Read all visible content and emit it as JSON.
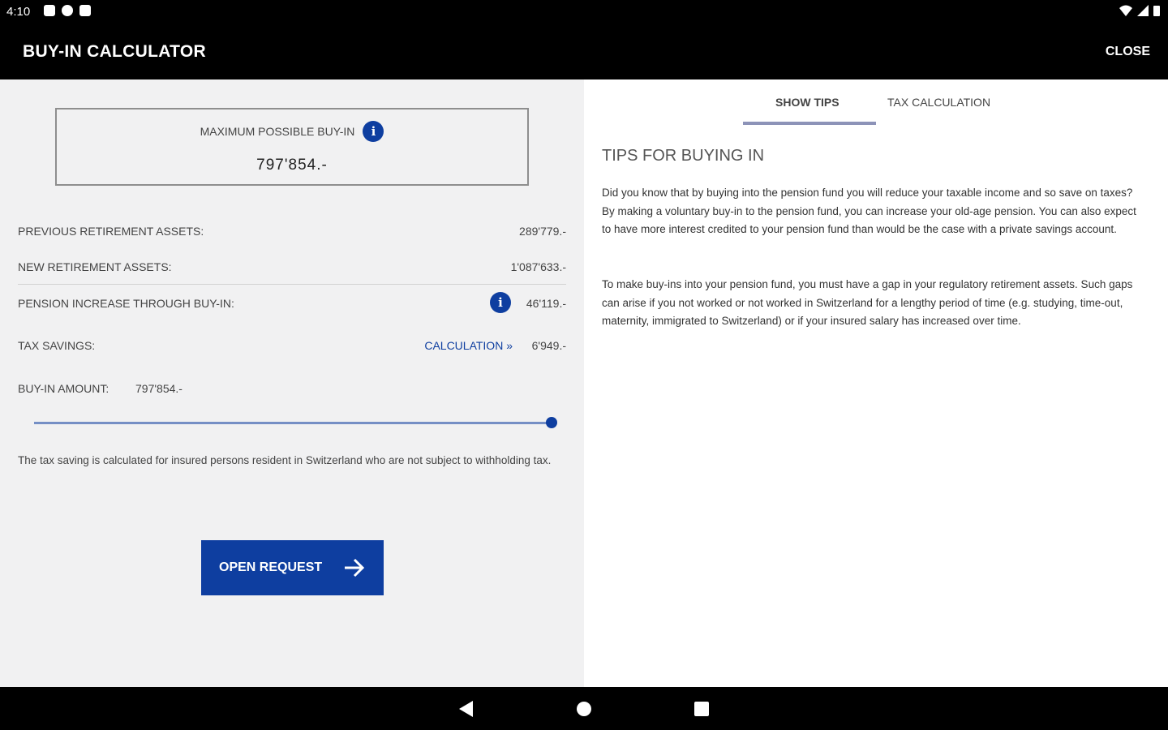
{
  "status_bar": {
    "time": "4:10"
  },
  "app_bar": {
    "title": "BUY-IN CALCULATOR",
    "close_label": "CLOSE"
  },
  "left_panel": {
    "max_buyin": {
      "label": "MAXIMUM POSSIBLE BUY-IN",
      "value": "797'854.-"
    },
    "rows": [
      {
        "label": "PREVIOUS RETIREMENT ASSETS:",
        "value": "289'779.-"
      },
      {
        "label": "NEW RETIREMENT ASSETS:",
        "value": "1'087'633.-"
      },
      {
        "label": "PENSION INCREASE THROUGH BUY-IN:",
        "value": "46'119.-"
      },
      {
        "label": "TAX SAVINGS:",
        "link": "CALCULATION »",
        "value": "6'949.-"
      }
    ],
    "buyin_amount": {
      "label": "BUY-IN AMOUNT:",
      "value": "797'854.-"
    },
    "slider_fraction": 1.0,
    "note": "The tax saving is calculated for insured persons resident in Switzerland who are not subject to withholding tax.",
    "button_label": "OPEN REQUEST"
  },
  "right_panel": {
    "tabs": [
      {
        "label": "SHOW TIPS",
        "active": true
      },
      {
        "label": "TAX CALCULATION",
        "active": false
      }
    ],
    "title": "TIPS FOR BUYING IN",
    "paragraphs": [
      "Did you know that by buying into the pension fund you will reduce your taxable income and so save on taxes? By making a voluntary buy-in to the pension fund, you can increase your old-age pension. You can also expect to have more interest credited to your pension fund than would be the case with a private savings account.",
      "To make buy-ins into your pension fund, you must have a gap in your regulatory retirement assets. Such gaps can arise if you not worked or not worked in Switzerland for a lengthy period of time (e.g. studying, time-out, maternity, immigrated to Switzerland) or if your insured salary has increased over time."
    ]
  },
  "colors": {
    "accent": "#0e3ea0",
    "left_bg": "#f1f1f2",
    "bar": "#000000"
  },
  "icons": {
    "info": "info-icon",
    "arrow": "arrow-right-icon",
    "back": "back-icon",
    "home": "home-icon",
    "recents": "recents-icon"
  }
}
